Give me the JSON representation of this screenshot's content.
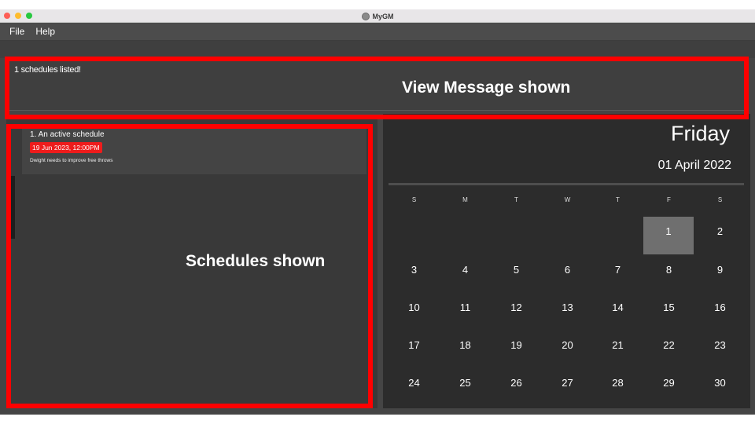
{
  "window": {
    "title": "MyGM",
    "colors": {
      "background": "#454545",
      "calendar_bg": "#2c2c2c",
      "highlight": "#ee1c1c",
      "annotation": "#ff0000"
    }
  },
  "menu": {
    "items": [
      "File",
      "Help"
    ]
  },
  "result": {
    "message": "1 schedules listed!"
  },
  "schedules": [
    {
      "title": "1.  An active schedule",
      "datetime": "19 Jun 2023, 12:00PM",
      "description": "Dwight needs to improve free throws"
    }
  ],
  "calendar": {
    "day_name": "Friday",
    "date": "01 April 2022",
    "weekdays": [
      "S",
      "M",
      "T",
      "W",
      "T",
      "F",
      "S"
    ],
    "selected_day": 1,
    "weeks": [
      [
        "",
        "",
        "",
        "",
        "",
        "1",
        "2"
      ],
      [
        "3",
        "4",
        "5",
        "6",
        "7",
        "8",
        "9"
      ],
      [
        "10",
        "11",
        "12",
        "13",
        "14",
        "15",
        "16"
      ],
      [
        "17",
        "18",
        "19",
        "20",
        "21",
        "22",
        "23"
      ],
      [
        "24",
        "25",
        "26",
        "27",
        "28",
        "29",
        "30"
      ]
    ]
  },
  "annotations": {
    "view_message": "View Message shown",
    "schedules": "Schedules shown"
  }
}
